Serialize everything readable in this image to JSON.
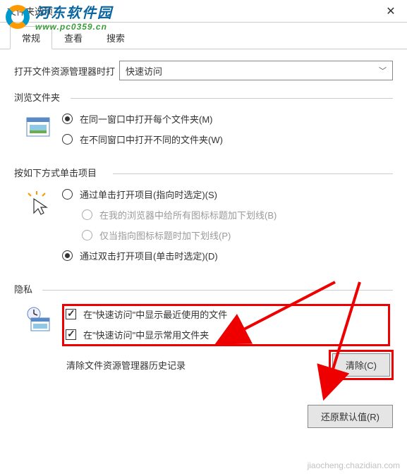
{
  "window": {
    "title": "文件夹选项"
  },
  "logo": {
    "main": "河东软件园",
    "sub": "www.pc0359.cn"
  },
  "tabs": [
    {
      "label": "常规",
      "active": true
    },
    {
      "label": "查看",
      "active": false
    },
    {
      "label": "搜索",
      "active": false
    }
  ],
  "open_explorer": {
    "label": "打开文件资源管理器时打",
    "selected": "快速访问"
  },
  "browse_group": {
    "title": "浏览文件夹",
    "opt1": "在同一窗口中打开每个文件夹(M)",
    "opt2": "在不同窗口中打开不同的文件夹(W)"
  },
  "click_group": {
    "title": "按如下方式单击项目",
    "opt1": "通过单击打开项目(指向时选定)(S)",
    "sub1": "在我的浏览器中给所有图标标题加下划线(B)",
    "sub2": "仅当指向图标标题时加下划线(P)",
    "opt2": "通过双击打开项目(单击时选定)(D)"
  },
  "privacy_group": {
    "title": "隐私",
    "chk1": "在\"快速访问\"中显示最近使用的文件",
    "chk2": "在\"快速访问\"中显示常用文件夹",
    "clear_label": "清除文件资源管理器历史记录",
    "clear_btn": "清除(C)"
  },
  "footer": {
    "restore": "还原默认值(R)"
  },
  "watermark": "jiaocheng.chazidian.com"
}
